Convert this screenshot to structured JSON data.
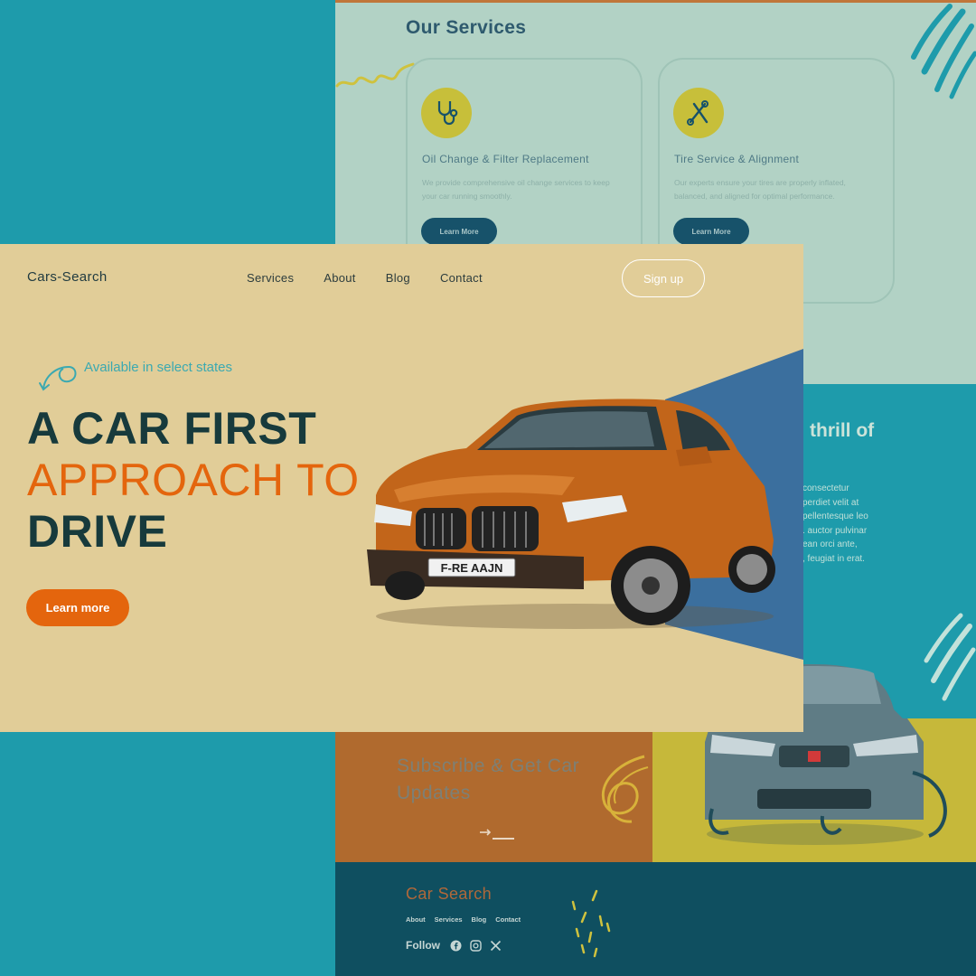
{
  "back_services": {
    "title": "Our Services",
    "cards": [
      {
        "name": "Oil Change & Filter Replacement",
        "description": "We provide comprehensive oil change services to keep your car running smoothly.",
        "button": "Learn More",
        "icon": "stethoscope-icon"
      },
      {
        "name": "Tire Service & Alignment",
        "description": "Our experts ensure your tires are properly inflated, balanced, and aligned for optimal performance.",
        "button": "Learn More",
        "icon": "tools-icon"
      }
    ]
  },
  "back_teal": {
    "title_fragment": "thrill of",
    "text_fragment": "consectetur\nperdiet velit at\npellentesque leo\n. auctor pulvinar\nean orci ante,\n, feugiat in erat."
  },
  "subscribe": {
    "title": "Subscribe & Get Car Updates"
  },
  "footer": {
    "brand": "Car Search",
    "links": [
      "About",
      "Services",
      "Blog",
      "Contact"
    ],
    "follow_label": "Follow"
  },
  "hero": {
    "brand": "Cars-Search",
    "nav": [
      "Services",
      "About",
      "Blog",
      "Contact"
    ],
    "signup": "Sign up",
    "availability": "Available in select states",
    "headline_line1": "A CAR FIRST",
    "headline_line2": "APPROACH TO",
    "headline_line3": "DRIVE",
    "cta": "Learn more",
    "license_plate": "F-RE AAJN"
  },
  "colors": {
    "teal_bg": "#1e9bab",
    "sand_hero": "#e1cd98",
    "orange_accent": "#e4650d",
    "dark_teal": "#173a3c",
    "mint": "#b2d2c5",
    "footer_navy": "#0f4f60",
    "mustard": "#c6b83a",
    "rust": "#b06a2e",
    "wedge_blue": "#3b6f9e"
  }
}
